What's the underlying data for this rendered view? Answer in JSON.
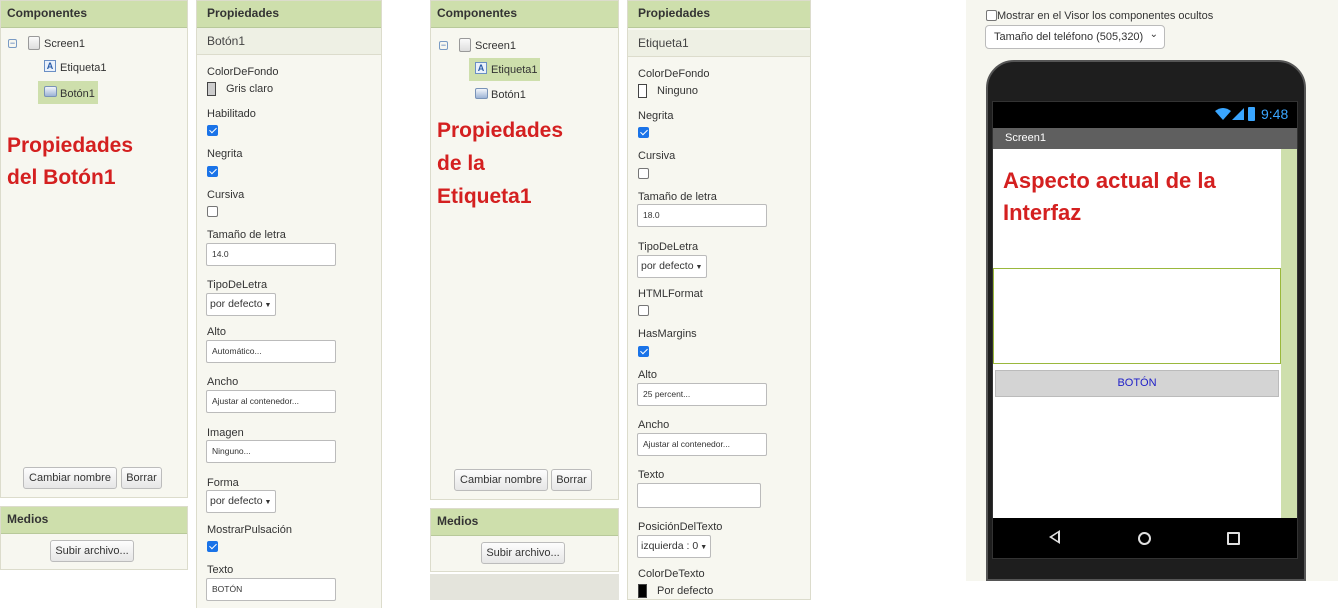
{
  "left": {
    "components_title": "Componentes",
    "tree": {
      "screen": "Screen1",
      "label": "Etiqueta1",
      "button": "Botón1"
    },
    "annotation": [
      "Propiedades",
      "del Botón1"
    ],
    "rename_button": "Cambiar nombre",
    "delete_button": "Borrar",
    "media_title": "Medios",
    "upload_button": "Subir archivo...",
    "properties_title": "Propiedades",
    "component_name": "Botón1",
    "props": {
      "bg_label": "ColorDeFondo",
      "bg_value": "Gris claro",
      "enabled_label": "Habilitado",
      "bold_label": "Negrita",
      "italic_label": "Cursiva",
      "fontsize_label": "Tamaño de letra",
      "fontsize_value": "14.0",
      "font_label": "TipoDeLetra",
      "font_value": "por defecto",
      "height_label": "Alto",
      "height_value": "Automático...",
      "width_label": "Ancho",
      "width_value": "Ajustar al contenedor...",
      "image_label": "Imagen",
      "image_value": "Ninguno...",
      "shape_label": "Forma",
      "shape_value": "por defecto",
      "feedback_label": "MostrarPulsación",
      "text_label": "Texto",
      "text_value": "BOTÓN"
    }
  },
  "middle": {
    "components_title": "Componentes",
    "tree": {
      "screen": "Screen1",
      "label": "Etiqueta1",
      "button": "Botón1"
    },
    "annotation": [
      "Propiedades",
      "de la",
      "Etiqueta1"
    ],
    "rename_button": "Cambiar nombre",
    "delete_button": "Borrar",
    "media_title": "Medios",
    "upload_button": "Subir archivo...",
    "properties_title": "Propiedades",
    "component_name": "Etiqueta1",
    "props": {
      "bg_label": "ColorDeFondo",
      "bg_value": "Ninguno",
      "bold_label": "Negrita",
      "italic_label": "Cursiva",
      "fontsize_label": "Tamaño de letra",
      "fontsize_value": "18.0",
      "font_label": "TipoDeLetra",
      "font_value": "por defecto",
      "html_label": "HTMLFormat",
      "margins_label": "HasMargins",
      "height_label": "Alto",
      "height_value": "25 percent...",
      "width_label": "Ancho",
      "width_value": "Ajustar al contenedor...",
      "text_label": "Texto",
      "text_value": "",
      "align_label": "PosiciónDelTexto",
      "align_value": "izquierda : 0",
      "textcolor_label": "ColorDeTexto",
      "textcolor_value": "Por defecto"
    }
  },
  "viewer": {
    "hidden_checkbox_label": "Mostrar en el Visor los componentes ocultos",
    "phone_size": "Tamaño del teléfono (505,320)",
    "time": "9:48",
    "screen_title": "Screen1",
    "annotation": [
      "Aspecto actual de la",
      "Interfaz"
    ],
    "button_text": "BOTÓN"
  },
  "colors": {
    "panel_header": "#cedfac",
    "annotation": "#d42020",
    "phone_button_text": "#2020c8",
    "label_border": "#9ab83c"
  }
}
